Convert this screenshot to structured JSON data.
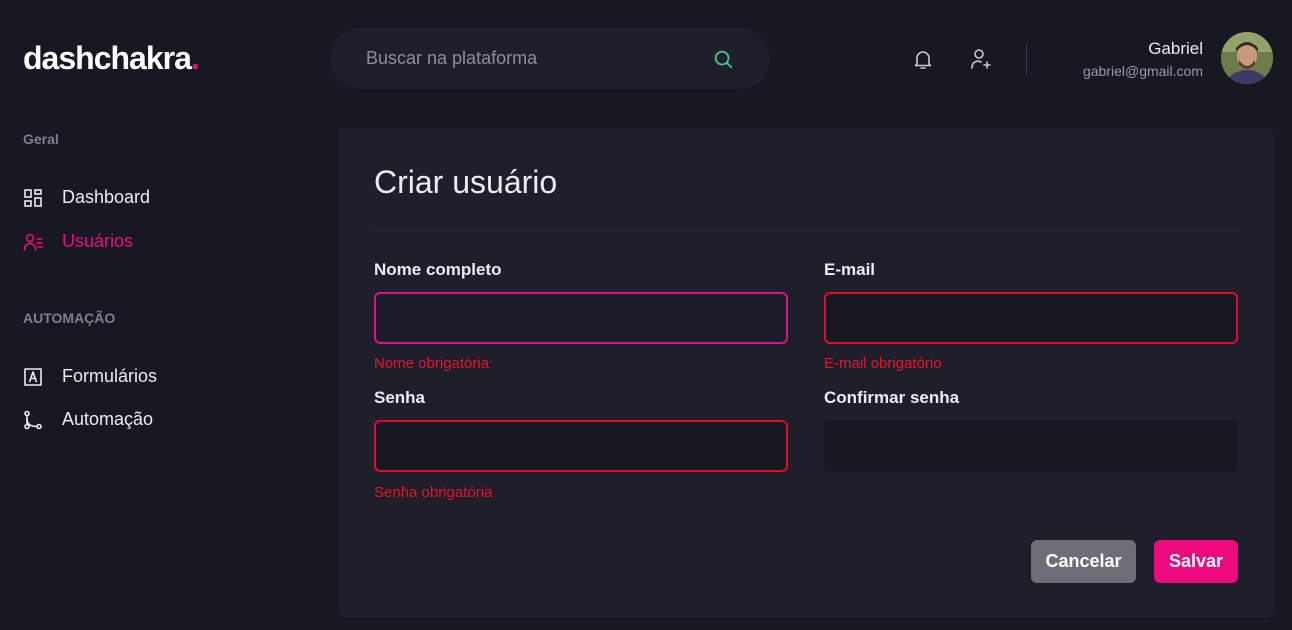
{
  "brand": {
    "name": "dashchakra",
    "dot": "."
  },
  "search": {
    "placeholder": "Buscar na plataforma"
  },
  "user": {
    "name": "Gabriel",
    "email": "gabriel@gmail.com"
  },
  "sidebar": {
    "sections": [
      {
        "title": "Geral",
        "items": [
          {
            "label": "Dashboard",
            "icon": "dashboard-icon"
          },
          {
            "label": "Usuários",
            "icon": "users-icon",
            "active": true
          }
        ]
      },
      {
        "title": "AUTOMAÇÃO",
        "items": [
          {
            "label": "Formulários",
            "icon": "form-icon"
          },
          {
            "label": "Automação",
            "icon": "git-branch-icon"
          }
        ]
      }
    ]
  },
  "form": {
    "title": "Criar usuário",
    "fields": {
      "name": {
        "label": "Nome completo",
        "value": "",
        "error": "Nome obrigatória"
      },
      "email": {
        "label": "E-mail",
        "value": "",
        "error": "E-mail obrigatório"
      },
      "password": {
        "label": "Senha",
        "value": "",
        "error": "Senha obrigatória"
      },
      "confirm": {
        "label": "Confirmar senha",
        "value": ""
      }
    },
    "buttons": {
      "cancel": "Cancelar",
      "save": "Salvar"
    }
  },
  "colors": {
    "accent": "#eb0b7f",
    "error": "#e6132b",
    "background": "#181823",
    "card": "#1f1e2b",
    "search_icon": "#41c792"
  }
}
